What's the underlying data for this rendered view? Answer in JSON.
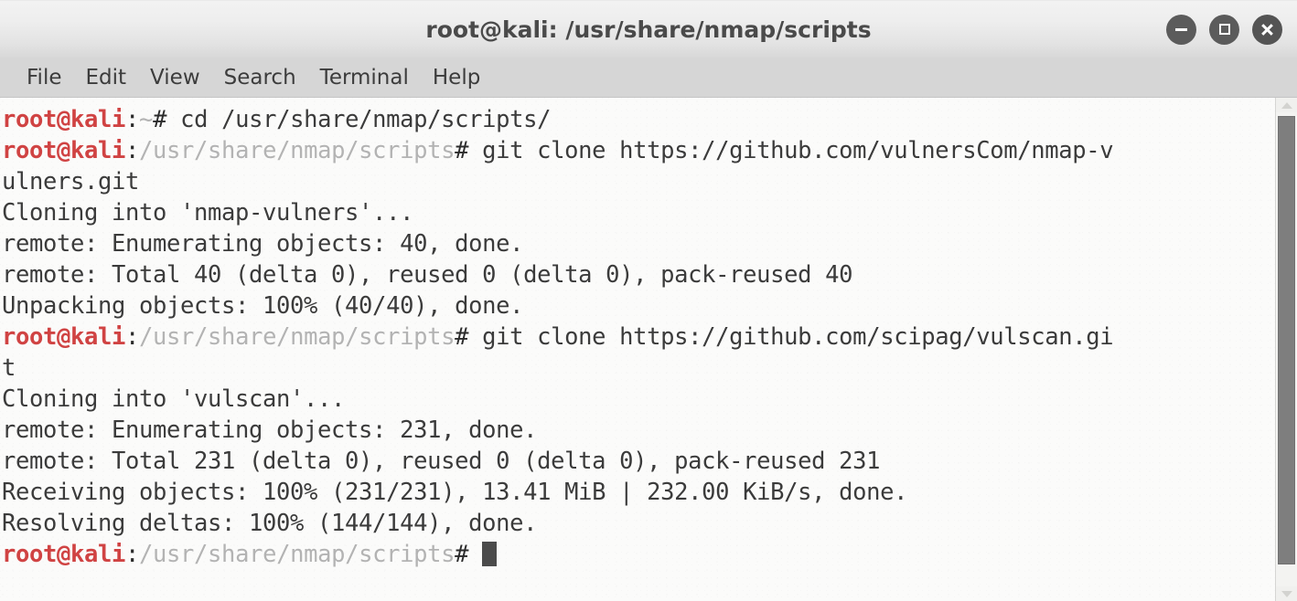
{
  "window": {
    "title": "root@kali: /usr/share/nmap/scripts",
    "controls": [
      {
        "name": "minimize",
        "glyph": "minus-icon"
      },
      {
        "name": "maximize",
        "glyph": "square-restore-icon"
      },
      {
        "name": "close",
        "glyph": "close-x-icon"
      }
    ]
  },
  "menubar": {
    "items": [
      "File",
      "Edit",
      "View",
      "Search",
      "Terminal",
      "Help"
    ]
  },
  "colors": {
    "prompt_user": "#d04343",
    "prompt_path": "#b3b3b3",
    "text": "#3b3b3b",
    "terminal_bg": "#fbfbfa",
    "titlebar_bg": "#eeeeee",
    "menubar_bg": "#d6d6d6",
    "scrollbar_thumb": "#7e7e7e",
    "cursor": "#4b4b4b"
  },
  "terminal": {
    "lines": [
      {
        "type": "prompt",
        "user": "root@kali",
        "colon": ":",
        "path": "~",
        "hash": "# ",
        "command": "cd /usr/share/nmap/scripts/"
      },
      {
        "type": "prompt",
        "user": "root@kali",
        "colon": ":",
        "path": "/usr/share/nmap/scripts",
        "hash": "# ",
        "command": "git clone https://github.com/vulnersCom/nmap-v"
      },
      {
        "type": "output",
        "text": "ulners.git"
      },
      {
        "type": "output",
        "text": "Cloning into 'nmap-vulners'..."
      },
      {
        "type": "output",
        "text": "remote: Enumerating objects: 40, done."
      },
      {
        "type": "output",
        "text": "remote: Total 40 (delta 0), reused 0 (delta 0), pack-reused 40"
      },
      {
        "type": "output",
        "text": "Unpacking objects: 100% (40/40), done."
      },
      {
        "type": "prompt",
        "user": "root@kali",
        "colon": ":",
        "path": "/usr/share/nmap/scripts",
        "hash": "# ",
        "command": "git clone https://github.com/scipag/vulscan.gi"
      },
      {
        "type": "output",
        "text": "t"
      },
      {
        "type": "output",
        "text": "Cloning into 'vulscan'..."
      },
      {
        "type": "output",
        "text": "remote: Enumerating objects: 231, done."
      },
      {
        "type": "output",
        "text": "remote: Total 231 (delta 0), reused 0 (delta 0), pack-reused 231"
      },
      {
        "type": "output",
        "text": "Receiving objects: 100% (231/231), 13.41 MiB | 232.00 KiB/s, done."
      },
      {
        "type": "output",
        "text": "Resolving deltas: 100% (144/144), done."
      },
      {
        "type": "prompt",
        "user": "root@kali",
        "colon": ":",
        "path": "/usr/share/nmap/scripts",
        "hash": "# ",
        "command": "",
        "cursor": true
      }
    ]
  },
  "scrollbar": {
    "up_arrow": "scroll-up-arrow",
    "down_arrow": "scroll-down-arrow",
    "thumb_position_percent": 100
  }
}
